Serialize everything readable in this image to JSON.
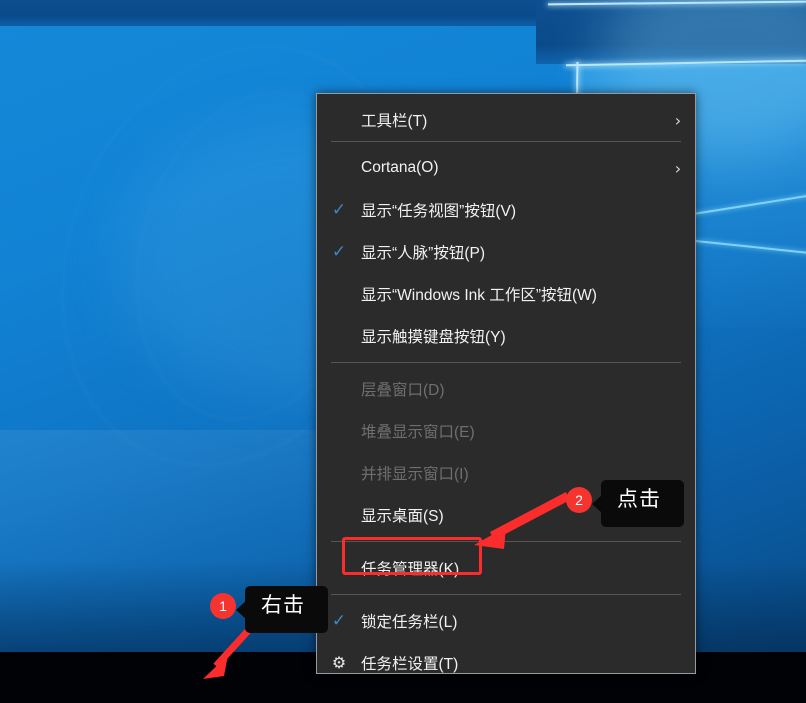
{
  "desktop": {
    "wallpaper_name": "windows-10-hero-wallpaper",
    "taskbar_name": "windows-taskbar",
    "colors": {
      "wallpaper_blue": "#1283d4",
      "taskbar_black": "#000205",
      "menu_bg": "#2b2b2b",
      "menu_border": "#9a9a9a",
      "menu_text": "#f2f2f2",
      "menu_text_disabled": "#6f6f6f",
      "separator": "#565656",
      "check_blue": "#3f86c8",
      "annotation_red": "#fb2c2c",
      "badge_red": "#f5332f",
      "tooltip_black": "#0a0a0a"
    }
  },
  "context_menu": {
    "name": "taskbar-context-menu",
    "groups": [
      {
        "items": [
          {
            "label": "工具栏(T)",
            "icon": "",
            "chevron": "›",
            "disabled": false,
            "submenu": true
          }
        ]
      },
      {
        "items": [
          {
            "label": "Cortana(O)",
            "icon": "",
            "chevron": "›",
            "disabled": false,
            "submenu": true
          },
          {
            "label": "显示“任务视图”按钮(V)",
            "icon": "check",
            "chevron": "",
            "disabled": false,
            "submenu": false
          },
          {
            "label": "显示“人脉”按钮(P)",
            "icon": "check",
            "chevron": "",
            "disabled": false,
            "submenu": false
          },
          {
            "label": "显示“Windows Ink 工作区”按钮(W)",
            "icon": "",
            "chevron": "",
            "disabled": false,
            "submenu": false
          },
          {
            "label": "显示触摸键盘按钮(Y)",
            "icon": "",
            "chevron": "",
            "disabled": false,
            "submenu": false
          }
        ]
      },
      {
        "items": [
          {
            "label": "层叠窗口(D)",
            "icon": "",
            "chevron": "",
            "disabled": true,
            "submenu": false
          },
          {
            "label": "堆叠显示窗口(E)",
            "icon": "",
            "chevron": "",
            "disabled": true,
            "submenu": false
          },
          {
            "label": "并排显示窗口(I)",
            "icon": "",
            "chevron": "",
            "disabled": true,
            "submenu": false
          },
          {
            "label": "显示桌面(S)",
            "icon": "",
            "chevron": "",
            "disabled": false,
            "submenu": false
          }
        ]
      },
      {
        "items": [
          {
            "label": "任务管理器(K)",
            "icon": "",
            "chevron": "",
            "disabled": false,
            "submenu": false,
            "highlighted": true
          }
        ]
      },
      {
        "items": [
          {
            "label": "锁定任务栏(L)",
            "icon": "check",
            "chevron": "",
            "disabled": false,
            "submenu": false
          },
          {
            "label": "任务栏设置(T)",
            "icon": "gear",
            "chevron": "",
            "disabled": false,
            "submenu": false
          }
        ]
      }
    ]
  },
  "annotations": {
    "step1": {
      "badge": "1",
      "tooltip": "右击",
      "target": "taskbar-empty-area"
    },
    "step2": {
      "badge": "2",
      "tooltip": "点击",
      "target": "menu-item-task-manager"
    }
  }
}
